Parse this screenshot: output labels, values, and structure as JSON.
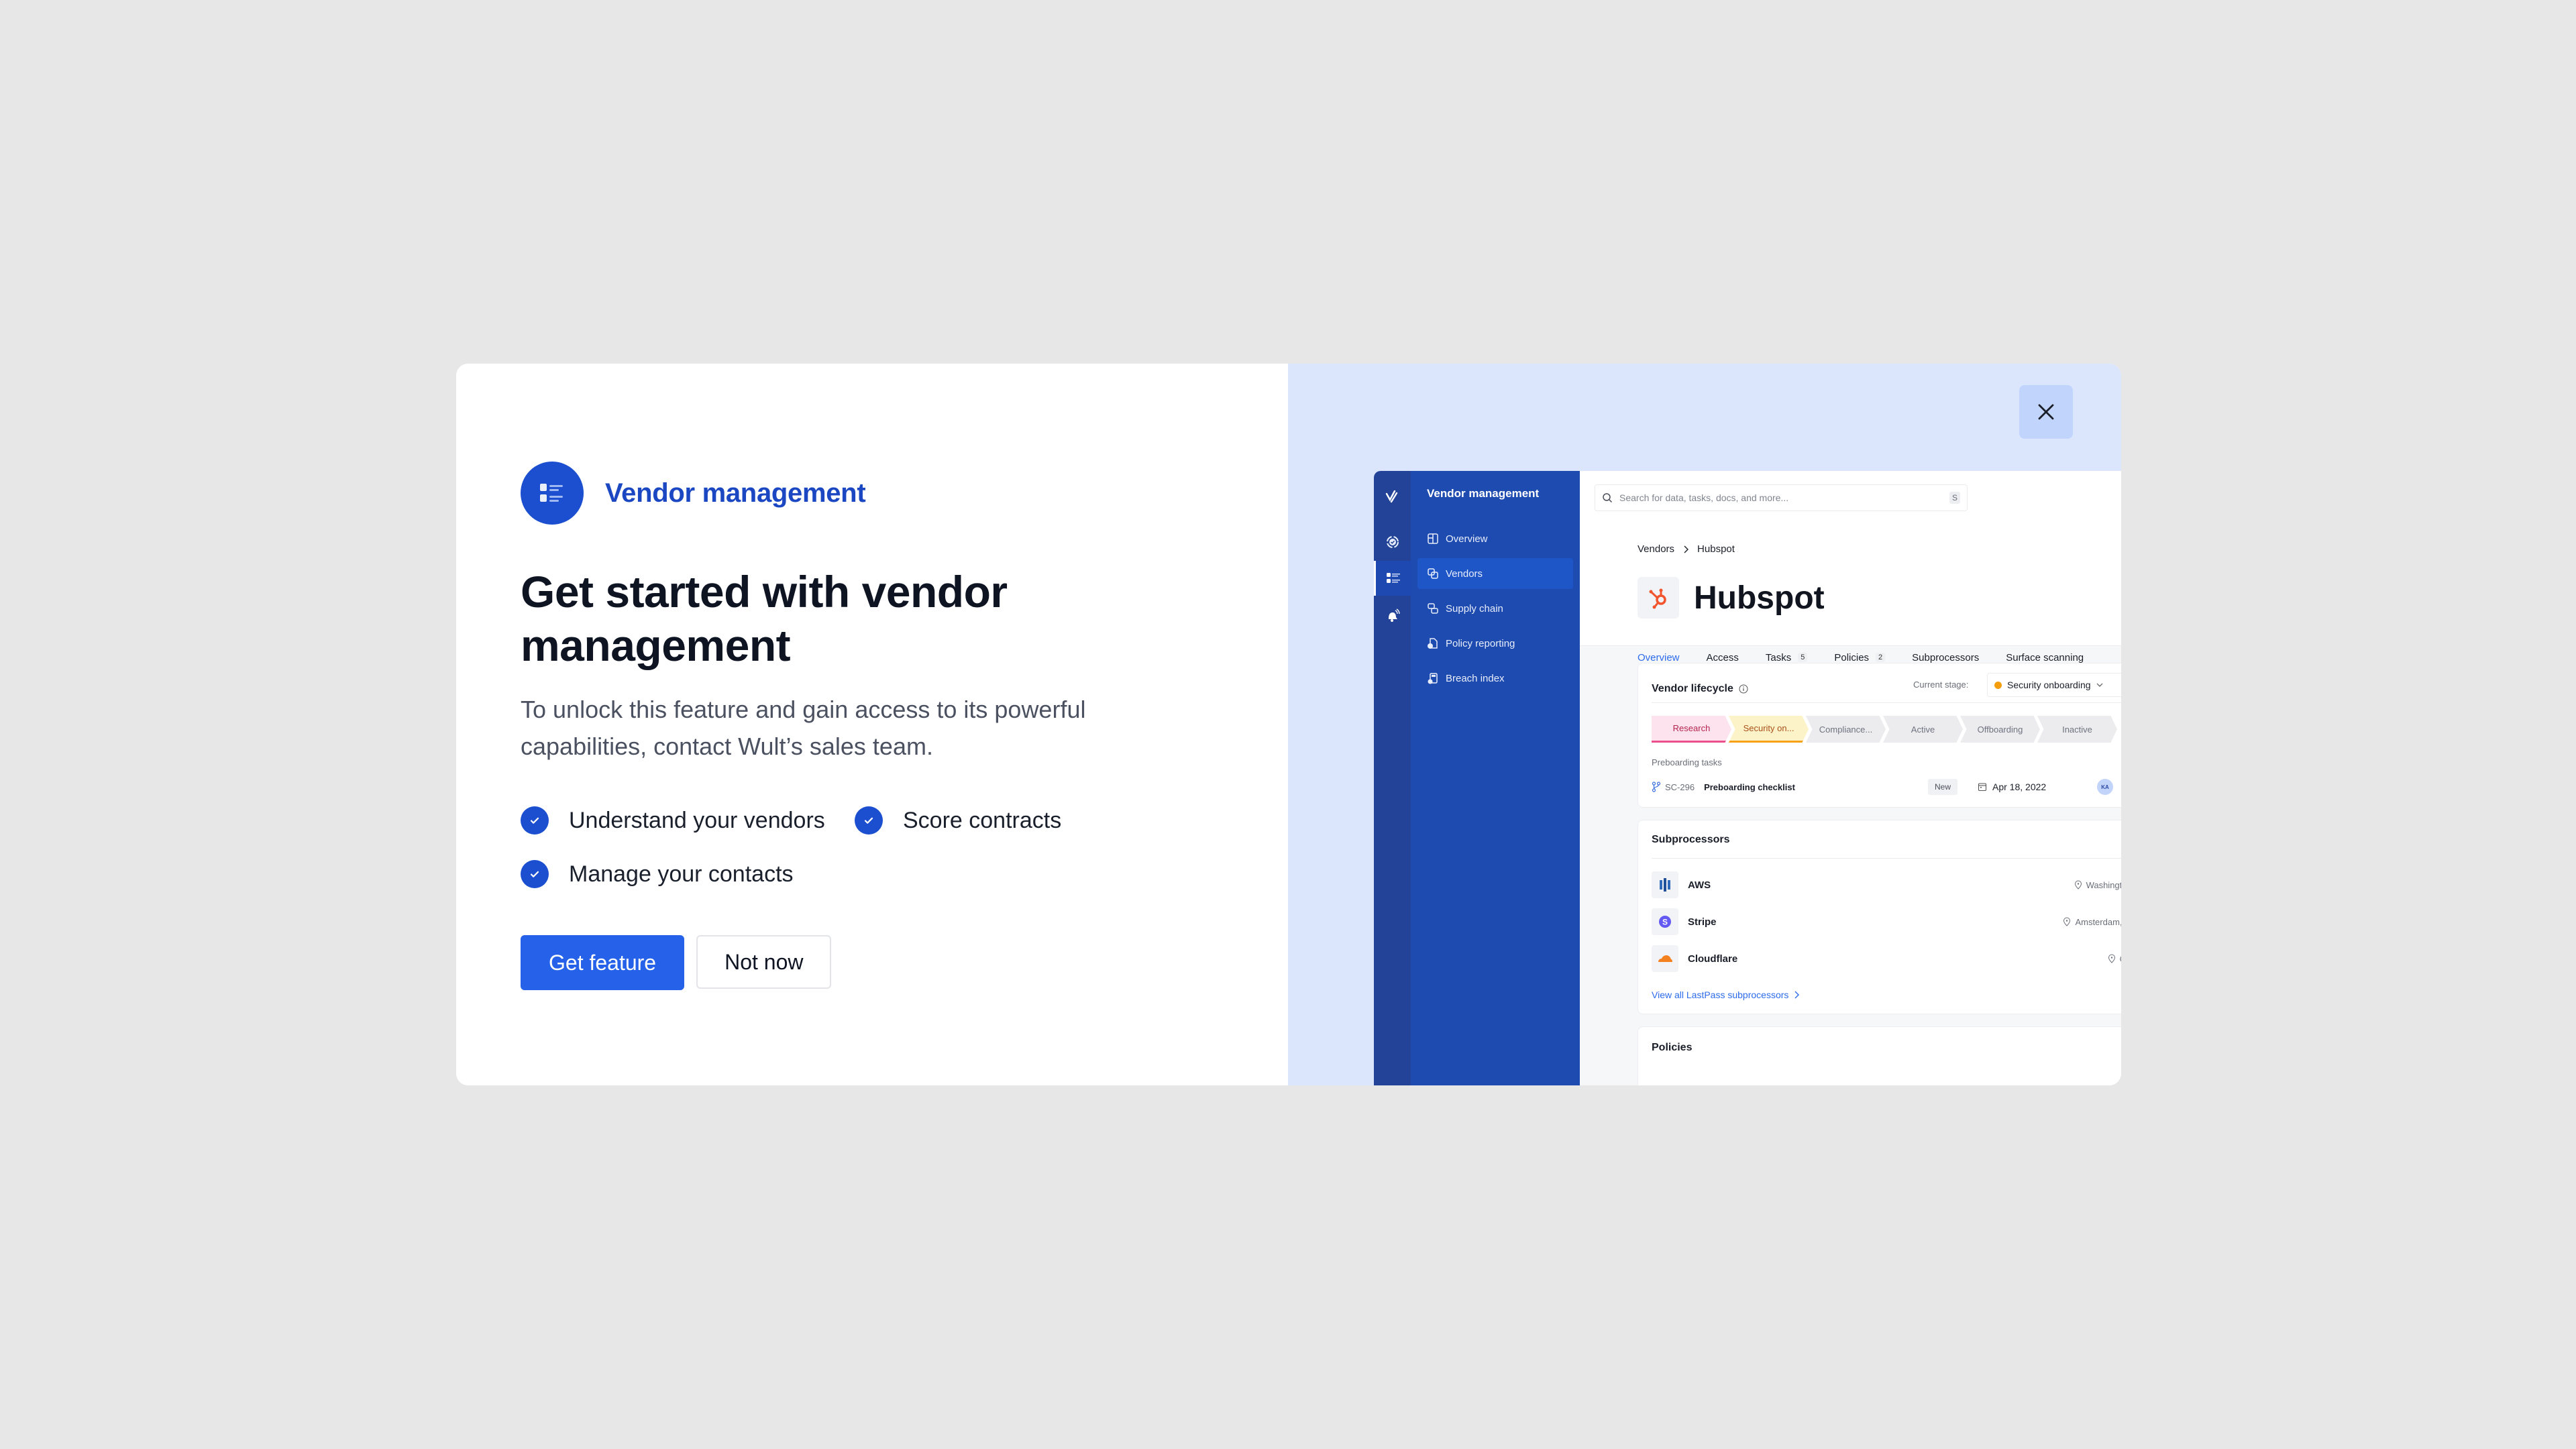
{
  "dialog": {
    "brand_label": "Vendor management",
    "brand_icon": "list-icon",
    "title": "Get started with vendor management",
    "description": "To unlock this feature and gain access to its powerful capabilities, contact Wult’s sales team.",
    "benefits": [
      {
        "label": "Understand your vendors",
        "icon": "check-circle-icon"
      },
      {
        "label": "Score contracts",
        "icon": "check-circle-icon"
      },
      {
        "label": "Manage your contacts",
        "icon": "check-circle-icon"
      }
    ],
    "primary_button": "Get feature",
    "secondary_button": "Not now",
    "close_icon": "close-icon",
    "colors": {
      "brand_blue": "#1c4fcf",
      "primary_button": "#2562e9",
      "preview_bg": "#dbe6fd",
      "close_bg": "#c1d4fb"
    }
  },
  "preview": {
    "sidebar": {
      "title": "Vendor management",
      "rail_icons": [
        "logo-icon",
        "compliance-icon",
        "vendor-list-icon",
        "alert-bell-icon"
      ],
      "items": [
        {
          "label": "Overview",
          "icon": "layout-icon",
          "active": false
        },
        {
          "label": "Vendors",
          "icon": "copy-icon",
          "active": true
        },
        {
          "label": "Supply chain",
          "icon": "link-icon",
          "active": false
        },
        {
          "label": "Policy reporting",
          "icon": "document-check-icon",
          "active": false
        },
        {
          "label": "Breach index",
          "icon": "breach-icon",
          "active": false
        }
      ]
    },
    "search": {
      "placeholder": "Search for data, tasks, docs, and more...",
      "shortcut": "S"
    },
    "breadcrumb": [
      "Vendors",
      "Hubspot"
    ],
    "vendor_name": "Hubspot",
    "tabs": [
      {
        "label": "Overview",
        "count": null,
        "active": true
      },
      {
        "label": "Access",
        "count": null,
        "active": false
      },
      {
        "label": "Tasks",
        "count": "5",
        "active": false
      },
      {
        "label": "Policies",
        "count": "2",
        "active": false
      },
      {
        "label": "Subprocessors",
        "count": null,
        "active": false
      },
      {
        "label": "Surface scanning",
        "count": null,
        "active": false
      }
    ],
    "lifecycle": {
      "title": "Vendor lifecycle",
      "current_stage_label": "Current stage:",
      "current_stage": "Security onboarding",
      "stages": [
        "Research",
        "Security on...",
        "Compliance...",
        "Active",
        "Offboarding",
        "Inactive"
      ],
      "tasks_label": "Preboarding tasks",
      "task": {
        "id": "SC-296",
        "name": "Preboarding checklist",
        "status": "New",
        "date": "Apr 18, 2022",
        "assignee": "KA"
      }
    },
    "subprocessors": {
      "title": "Subprocessors",
      "items": [
        {
          "name": "AWS",
          "location": "Washington, United States"
        },
        {
          "name": "Stripe",
          "location": "Amsterdam, The Netherlands"
        },
        {
          "name": "Cloudflare",
          "location": "CA, United States"
        }
      ],
      "view_all": "View all LastPass subprocessors"
    },
    "policies": {
      "title": "Policies"
    }
  }
}
